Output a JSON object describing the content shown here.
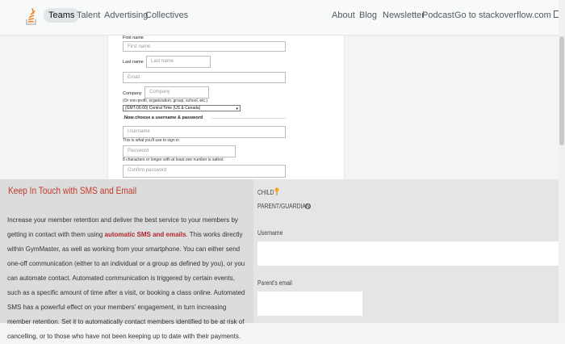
{
  "nav": {
    "items": [
      "Teams",
      "Talent",
      "Advertising",
      "Collectives"
    ],
    "right": [
      "About",
      "Blog",
      "Newsletter",
      "Podcast",
      "Go to stackoverflow.com"
    ]
  },
  "form": {
    "first_name_label": "First name",
    "first_name_placeholder": "First name",
    "last_name_label": "Last name",
    "last_name_placeholder": "Last name",
    "email_placeholder": "Email",
    "company_label": "Company",
    "company_placeholder": "Company",
    "company_hint": "(Or non-profit, organization, group, school, etc.)",
    "timezone_value": "(GMT-06:00) Central Time (US & Canada)",
    "section_title": "Now choose a username & password",
    "username_placeholder": "Username",
    "username_hint": "This is what you'll use to sign in",
    "password_placeholder": "Password",
    "password_hint": "8 characters or longer with at least one number is safest.",
    "confirm_placeholder": "Confirm password"
  },
  "promo": {
    "title": "Keep In Touch with SMS and Email",
    "para_before": "Increase your member retention and deliver the best service to your members by getting in contact with them using ",
    "para_bold": "automatic SMS and emails",
    "para_after": ". This works directly within GymMaster, as well as working from your smartphone. You can either send one-off communication (either to an individual or a group as defined by you), or you can automate contact. Automated communication is triggered by certain events, such as a specific amount of time after a visit, or booking a class online. Automated SMS has a powerful effect on your members' engagement, in turn increasing member retention. Set it to automatically contact members identified to be at risk of cancelling, or to those who have not been keeping up to date with their payments."
  },
  "right_panel": {
    "child_label": "CHILD",
    "parent_label": "PARENT/GUARDIAN",
    "username_label": "Username",
    "parent_email_label": "Parent's email"
  },
  "colors": {
    "accent": "#f48024",
    "promo_title": "#c0392b"
  }
}
